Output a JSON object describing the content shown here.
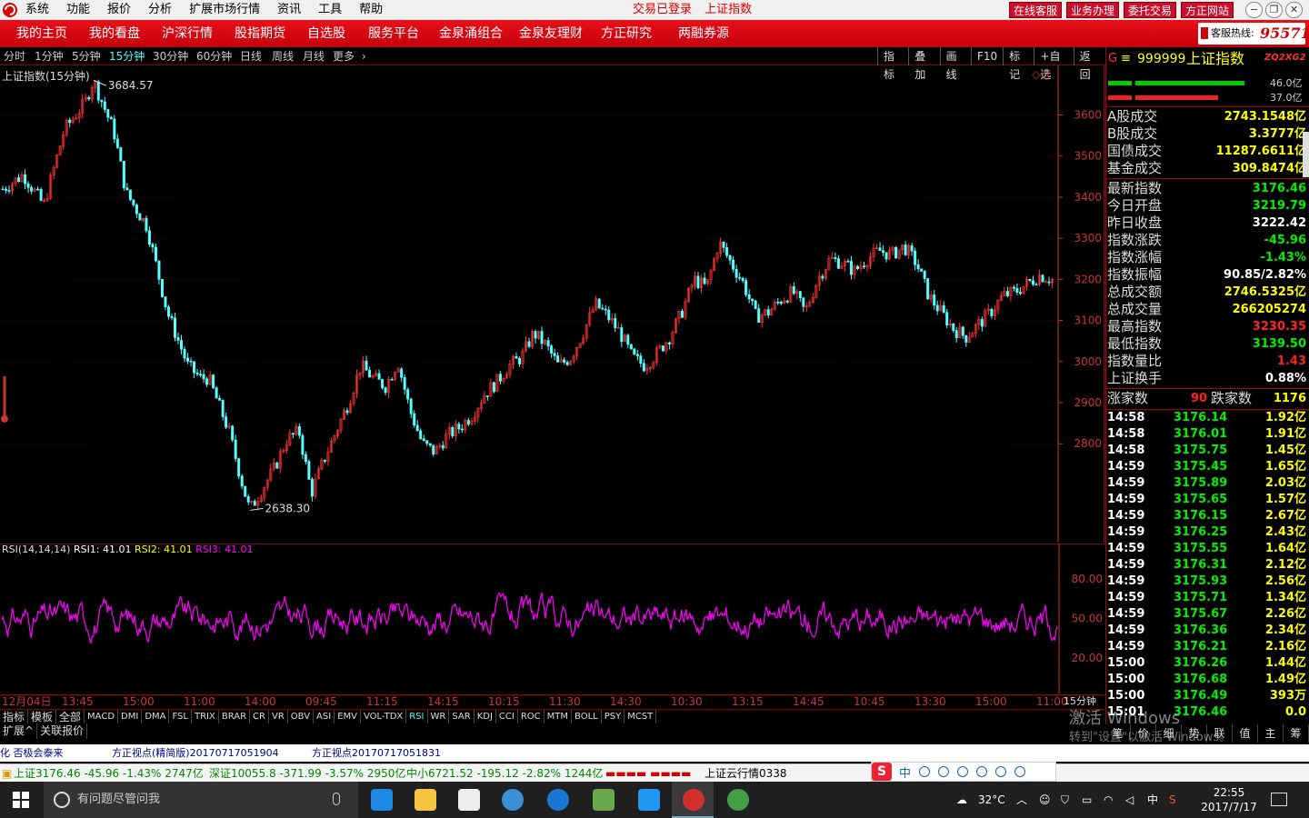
{
  "app": {
    "menu": [
      "系统",
      "功能",
      "报价",
      "分析",
      "扩展市场行情",
      "资讯",
      "工具",
      "帮助"
    ],
    "status": [
      "交易已登录",
      "上证指数"
    ],
    "top_buttons": [
      "在线客服",
      "业务办理",
      "委托交易",
      "方正网站"
    ],
    "window_controls": [
      "−",
      "❐",
      "✕"
    ]
  },
  "nav": {
    "items": [
      "我的主页",
      "我的看盘",
      "沪深行情",
      "股指期货",
      "自选股",
      "服务平台",
      "金泉涌组合",
      "金泉友理财",
      "方正研究",
      "两融券源"
    ],
    "hotline_label": "客服热线:",
    "hotline_number": "95571"
  },
  "periods": [
    "分时",
    "1分钟",
    "5分钟",
    "15分钟",
    "30分钟",
    "60分钟",
    "日线",
    "周线",
    "月线",
    "更多",
    "›"
  ],
  "active_period": "15分钟",
  "tools": [
    "指标",
    "叠加",
    "画线",
    "F10",
    "标记",
    "+自选",
    "返回"
  ],
  "chart": {
    "label": "上证指数(15分钟)",
    "max_label": "3684.57",
    "min_label": "2638.30",
    "marks": "◇ ▯",
    "colors": {
      "up": "#ff3333",
      "down": "#54ffff",
      "axis": "#cc3333",
      "rsi": "#ff00ff"
    }
  },
  "chart_data": [
    {
      "type": "candlestick",
      "title": "上证指数(15分钟)",
      "y_ticks": [
        2800,
        2900,
        3000,
        3100,
        3200,
        3300,
        3400,
        3500,
        3600
      ],
      "ylim": [
        2560,
        3720
      ],
      "labels": {
        "max": 3684.57,
        "min": 2638.3
      },
      "x_ticks": [
        "12月04日",
        "13:45",
        "15:00",
        "11:00",
        "14:00",
        "09:45",
        "11:15",
        "14:15",
        "10:15",
        "11:30",
        "14:30",
        "10:30",
        "13:15",
        "14:45",
        "10:45",
        "13:30",
        "15:00",
        "11:00"
      ],
      "approx_close_path": [
        [
          0,
          3420
        ],
        [
          5,
          3455
        ],
        [
          10,
          3380
        ],
        [
          15,
          3565
        ],
        [
          20,
          3630
        ],
        [
          22,
          3684.57
        ],
        [
          27,
          3560
        ],
        [
          30,
          3410
        ],
        [
          35,
          3330
        ],
        [
          40,
          3120
        ],
        [
          45,
          2990
        ],
        [
          48,
          2960
        ],
        [
          50,
          2960
        ],
        [
          55,
          2830
        ],
        [
          58,
          2710
        ],
        [
          60,
          2638.3
        ],
        [
          63,
          2690
        ],
        [
          66,
          2740
        ],
        [
          69,
          2810
        ],
        [
          72,
          2830
        ],
        [
          75,
          2680
        ],
        [
          78,
          2760
        ],
        [
          81,
          2830
        ],
        [
          84,
          2900
        ],
        [
          87,
          2990
        ],
        [
          90,
          2960
        ],
        [
          93,
          2940
        ],
        [
          96,
          3000
        ],
        [
          99,
          2880
        ],
        [
          102,
          2800
        ],
        [
          105,
          2780
        ],
        [
          108,
          2820
        ],
        [
          111,
          2840
        ],
        [
          114,
          2870
        ],
        [
          117,
          2920
        ],
        [
          120,
          2950
        ],
        [
          123,
          2990
        ],
        [
          126,
          3010
        ],
        [
          129,
          3070
        ],
        [
          132,
          3040
        ],
        [
          135,
          2990
        ],
        [
          138,
          3010
        ],
        [
          141,
          3070
        ],
        [
          144,
          3140
        ],
        [
          147,
          3110
        ],
        [
          150,
          3070
        ],
        [
          153,
          3010
        ],
        [
          156,
          2990
        ],
        [
          159,
          3020
        ],
        [
          162,
          3060
        ],
        [
          165,
          3120
        ],
        [
          168,
          3200
        ],
        [
          171,
          3180
        ],
        [
          174,
          3290
        ],
        [
          177,
          3240
        ],
        [
          180,
          3190
        ],
        [
          183,
          3110
        ],
        [
          186,
          3120
        ],
        [
          189,
          3150
        ],
        [
          192,
          3170
        ],
        [
          195,
          3120
        ],
        [
          198,
          3200
        ],
        [
          201,
          3250
        ],
        [
          204,
          3240
        ],
        [
          207,
          3220
        ],
        [
          210,
          3250
        ],
        [
          213,
          3270
        ],
        [
          216,
          3260
        ],
        [
          219,
          3280
        ],
        [
          222,
          3240
        ],
        [
          225,
          3160
        ],
        [
          228,
          3120
        ],
        [
          231,
          3080
        ],
        [
          234,
          3060
        ],
        [
          237,
          3090
        ],
        [
          240,
          3120
        ],
        [
          243,
          3160
        ],
        [
          246,
          3170
        ],
        [
          249,
          3190
        ],
        [
          252,
          3210
        ],
        [
          255,
          3200
        ]
      ]
    },
    {
      "type": "line",
      "title": "RSI(14,14,14)",
      "series": [
        {
          "name": "RSI1",
          "last": 41.01
        },
        {
          "name": "RSI2",
          "last": 41.01
        },
        {
          "name": "RSI3",
          "last": 41.01
        }
      ],
      "y_ticks": [
        20,
        50,
        80
      ],
      "ylim": [
        0,
        100
      ]
    }
  ],
  "rsi": {
    "name": "RSI(14,14,14)",
    "r1": "RSI1: 41.01",
    "r2": "RSI2: 41.01",
    "r3": "RSI3: 41.01"
  },
  "time_axis": [
    "12月04日",
    "13:45",
    "15:00",
    "11:00",
    "14:00",
    "09:45",
    "11:15",
    "14:15",
    "10:15",
    "11:30",
    "14:30",
    "10:30",
    "13:15",
    "14:45",
    "10:45",
    "13:30",
    "15:00",
    "11:00"
  ],
  "period_indicator": "15分钟",
  "indicator_tabs": [
    "指标",
    "模板",
    "全部",
    "MACD",
    "DMI",
    "DMA",
    "FSL",
    "TRIX",
    "BRAR",
    "CR",
    "VR",
    "OBV",
    "ASI",
    "EMV",
    "VOL-TDX",
    "RSI",
    "WR",
    "SAR",
    "KDJ",
    "CCI",
    "ROC",
    "MTM",
    "BOLL",
    "PSY",
    "MCST"
  ],
  "active_indicator": "RSI",
  "sub_tabs": [
    "扩展^",
    "关联报价"
  ],
  "news": [
    "化 否极会泰来",
    "方正视点(精简版)20170717051904",
    "方正视点20170717051831"
  ],
  "ticker": {
    "sh": "上证3176.46 -45.96 -1.43% 2747亿",
    "sz": "深证10055.8 -371.99 -3.57% 2950亿",
    "zx": "中小6721.52 -195.12 -2.82% 1244亿",
    "cloud": "上证云行情0338"
  },
  "right_panel": {
    "header": {
      "g": "G",
      "icon": "≡",
      "code": "999999",
      "name": "上证指数",
      "tag": "ZQ2XG2"
    },
    "bars": [
      {
        "pct_label": "46.0亿",
        "value": 46.0
      },
      {
        "pct_label": "37.0亿",
        "value": 37.0
      }
    ],
    "turnover": [
      {
        "k": "A股成交",
        "v": "2743.1548亿"
      },
      {
        "k": "B股成交",
        "v": "3.3777亿"
      },
      {
        "k": "国债成交",
        "v": "11287.6611亿"
      },
      {
        "k": "基金成交",
        "v": "309.8474亿"
      }
    ],
    "stats": [
      {
        "k": "最新指数",
        "v": "3176.46",
        "c": "g"
      },
      {
        "k": "今日开盘",
        "v": "3219.79",
        "c": "g"
      },
      {
        "k": "昨日收盘",
        "v": "3222.42",
        "c": "w"
      },
      {
        "k": "指数涨跌",
        "v": "-45.96",
        "c": "g"
      },
      {
        "k": "指数涨幅",
        "v": "-1.43%",
        "c": "g"
      },
      {
        "k": "指数振幅",
        "v": "90.85/2.82%",
        "c": "w"
      },
      {
        "k": "总成交额",
        "v": "2746.5325亿",
        "c": "y"
      },
      {
        "k": "总成交量",
        "v": "266205274",
        "c": "y"
      },
      {
        "k": "最高指数",
        "v": "3230.35",
        "c": "r"
      },
      {
        "k": "最低指数",
        "v": "3139.50",
        "c": "g"
      },
      {
        "k": "指数量比",
        "v": "1.43",
        "c": "r"
      },
      {
        "k": "上证换手",
        "v": "0.88%",
        "c": "w"
      }
    ],
    "breadth": {
      "up_label": "涨家数",
      "up": "90",
      "down_label": "跌家数",
      "down": "1176"
    },
    "ticks": [
      [
        "14:58",
        "3176.14",
        "1.92亿"
      ],
      [
        "14:58",
        "3176.01",
        "1.91亿"
      ],
      [
        "14:58",
        "3175.75",
        "1.45亿"
      ],
      [
        "14:59",
        "3175.45",
        "1.65亿"
      ],
      [
        "14:59",
        "3175.89",
        "2.03亿"
      ],
      [
        "14:59",
        "3175.65",
        "1.57亿"
      ],
      [
        "14:59",
        "3176.15",
        "2.67亿"
      ],
      [
        "14:59",
        "3176.25",
        "2.43亿"
      ],
      [
        "14:59",
        "3175.55",
        "1.64亿"
      ],
      [
        "14:59",
        "3176.31",
        "2.12亿"
      ],
      [
        "14:59",
        "3175.93",
        "2.56亿"
      ],
      [
        "14:59",
        "3175.71",
        "1.34亿"
      ],
      [
        "14:59",
        "3175.67",
        "2.26亿"
      ],
      [
        "14:59",
        "3176.36",
        "2.34亿"
      ],
      [
        "14:59",
        "3176.21",
        "2.16亿"
      ],
      [
        "15:00",
        "3176.26",
        "1.44亿"
      ],
      [
        "15:00",
        "3176.68",
        "1.49亿"
      ],
      [
        "15:00",
        "3176.49",
        "393万"
      ],
      [
        "15:01",
        "3176.46",
        "0.0"
      ]
    ],
    "footer": [
      "笔",
      "价",
      "细",
      "势",
      "联",
      "值",
      "主",
      "筹"
    ]
  },
  "watermark": {
    "line1": "激活 Windows",
    "line2": "转到\"设置\"以激活 Windows。"
  },
  "taskbar": {
    "search_placeholder": "有问题尽管问我",
    "temp": "32°C",
    "ime_lang": "中",
    "time": "22:55",
    "date": "2017/7/17"
  }
}
